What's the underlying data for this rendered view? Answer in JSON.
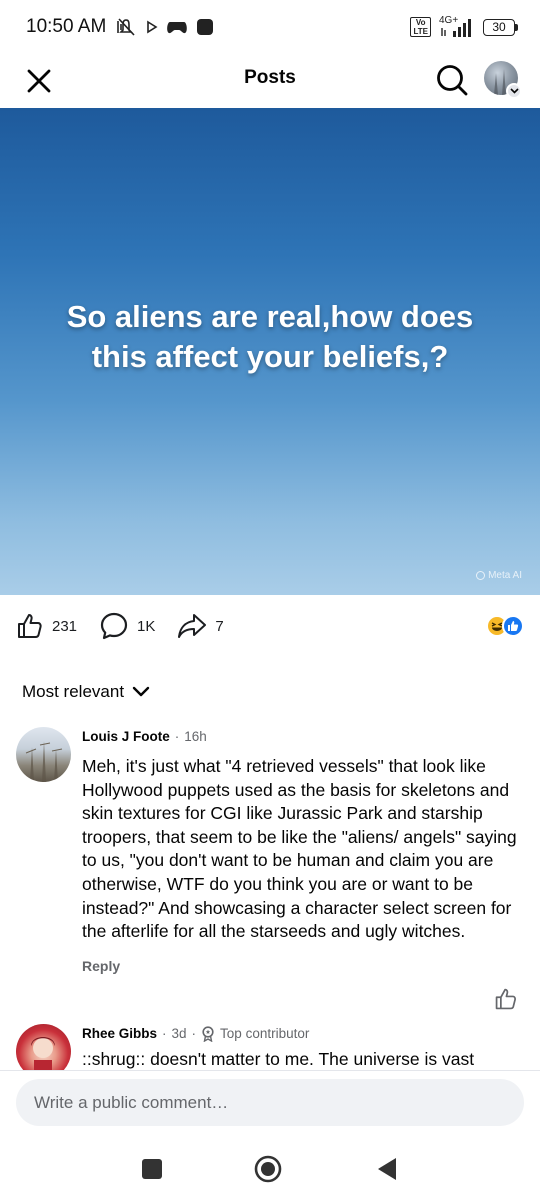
{
  "status_bar": {
    "time": "10:50 AM",
    "network": "4G+",
    "volte": "Vo\nLTE",
    "battery": "30"
  },
  "header": {
    "title": "Posts"
  },
  "post": {
    "image_text": "So aliens are real,how does this affect your beliefs,?",
    "image_tag": "Meta AI",
    "likes": "231",
    "comments": "1K",
    "shares": "7"
  },
  "sort": {
    "label": "Most relevant"
  },
  "comments": [
    {
      "name": "Louis J Foote",
      "time": "16h",
      "text": "Meh, it's just what \"4 retrieved vessels\" that look like Hollywood puppets used as the basis for skeletons and skin textures for CGI like Jurassic Park and starship troopers, that seem to be like the \"aliens/ angels\" saying to us, \"you don't want to be human and claim you are otherwise, WTF do you think you are or want to be instead?\" And showcasing a character select screen for the afterlife for all the starseeds and ugly witches.",
      "reply_label": "Reply"
    },
    {
      "name": "Rhee Gibbs",
      "time": "3d",
      "badge": "Top contributor",
      "text": "::shrug:: doesn't matter to me. The universe is vast"
    }
  ],
  "compose": {
    "placeholder": "Write a public comment…"
  },
  "icons": {
    "close": "close-icon",
    "search": "search-icon",
    "like": "thumbs-up-icon",
    "comment": "comment-bubble-icon",
    "share": "share-arrow-icon"
  },
  "colors": {
    "brand_blue": "#1877f2",
    "haha_yellow": "#f7b928",
    "secondary_text": "#65676b"
  }
}
